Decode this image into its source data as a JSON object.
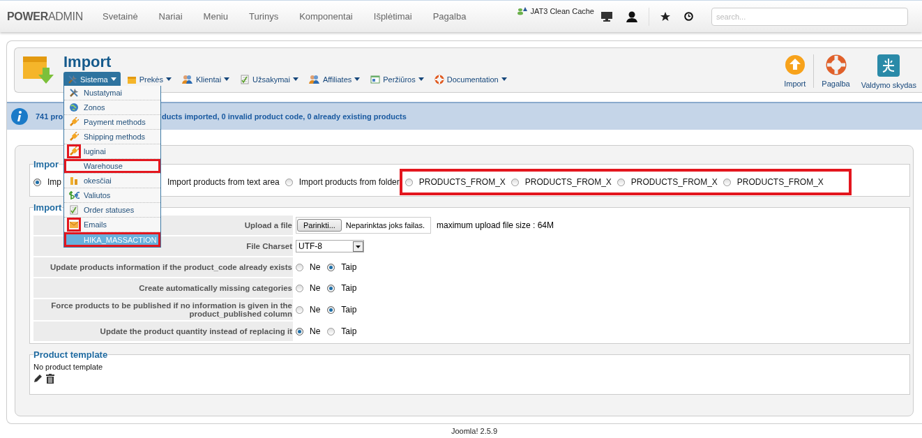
{
  "topbar": {
    "logo": "**POWER**ADMIN",
    "nav": [
      "Svetainė",
      "Nariai",
      "Meniu",
      "Turinys",
      "Komponentai",
      "Išplėtimai",
      "Pagalba"
    ],
    "cache_link": "JAT3 Clean Cache",
    "search": {
      "placeholder": "search..."
    }
  },
  "header": {
    "title": "Import",
    "menus": [
      {
        "label": "Sistema",
        "selected": true
      },
      {
        "label": "Prekės",
        "selected": false
      },
      {
        "label": "Klientai",
        "selected": false
      },
      {
        "label": "Užsakymai",
        "selected": false
      },
      {
        "label": "Affiliates",
        "selected": false
      },
      {
        "label": "Peržiūros",
        "selected": false
      },
      {
        "label": "Documentation",
        "selected": false
      }
    ],
    "toolbar": [
      "Import",
      "Pagalba",
      "Valdymo skydas"
    ]
  },
  "message": {
    "parts": [
      "741 pro",
      "ducts imported, 0 invalid product code, 0 already existing products"
    ]
  },
  "import_source": {
    "legend": "Impor",
    "options": [
      {
        "label": "Imp",
        "selected": true
      },
      {
        "label": "Import products from text area"
      },
      {
        "label": "Import products from folder",
        "selected": false
      }
    ],
    "extra_options": {
      "annotated": true,
      "items": [
        {
          "label": "PRODUCTS_FROM_X",
          "selected": false
        },
        {
          "label": "PRODUCTS_FROM_X",
          "selected": false
        },
        {
          "label": "PRODUCTS_FROM_X",
          "selected": false
        },
        {
          "label": "PRODUCTS_FROM_X",
          "selected": false
        }
      ]
    }
  },
  "settings": {
    "legend": "Import",
    "rows": [
      {
        "kind": "file",
        "label": "Upload a file",
        "button": "Parinkti...",
        "filename": "Neparinktas joks failas.",
        "note": "maximum upload file size : 64M"
      },
      {
        "kind": "select",
        "label": "File Charset",
        "value": "UTF-8"
      },
      {
        "kind": "choice",
        "label": "Update products information if the product_code already exists",
        "options": [
          {
            "label": "Ne",
            "selected": false
          },
          {
            "label": "Taip",
            "selected": true
          }
        ]
      },
      {
        "kind": "choice",
        "label": "Create automatically missing categories",
        "options": [
          {
            "label": "Ne",
            "selected": false
          },
          {
            "label": "Taip",
            "selected": true
          }
        ]
      },
      {
        "kind": "choice",
        "label": "Force products to be published if no information is given in the product_published column",
        "options": [
          {
            "label": "Ne",
            "selected": false
          },
          {
            "label": "Taip",
            "selected": true
          }
        ]
      },
      {
        "kind": "choice",
        "label": "Update the product quantity instead of replacing it",
        "options": [
          {
            "label": "Ne",
            "selected": true
          },
          {
            "label": "Taip",
            "selected": false
          }
        ]
      }
    ]
  },
  "product_template": {
    "legend": "Product template",
    "text": "No product template"
  },
  "sistema_menu": {
    "items": [
      {
        "label": "Nustatymai",
        "selected": false
      },
      {
        "label": "Zonos",
        "selected": false
      },
      {
        "label": "Payment methods",
        "selected": false
      },
      {
        "label": "Shipping methods",
        "selected": false
      },
      {
        "label": "luginai",
        "selected": false,
        "icon_boxed": true
      },
      {
        "label": "Warehouse",
        "selected": false,
        "row_boxed": true
      },
      {
        "label": "okesčiai",
        "selected": false
      },
      {
        "label": "Valiutos",
        "selected": false
      },
      {
        "label": "Order statuses",
        "selected": false
      },
      {
        "label": "Emails",
        "selected": false,
        "icon_boxed": true
      },
      {
        "label": "HIKA_MASSACTION",
        "selected": true,
        "row_boxed": true
      }
    ]
  },
  "footer": "Joomla! 2.5.9"
}
